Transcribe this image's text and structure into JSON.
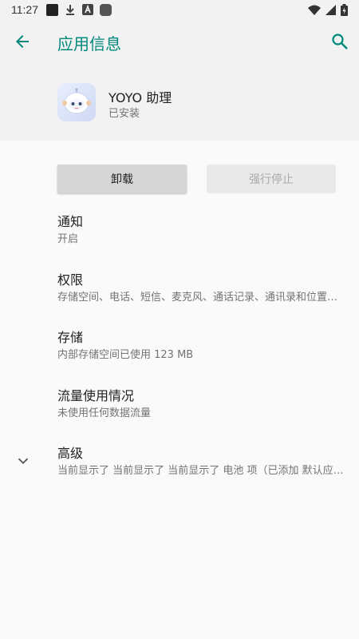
{
  "status_bar": {
    "time": "11:27",
    "icons": [
      "notification-square-icon",
      "download-icon",
      "app-notification-icon",
      "rounded-square-icon",
      "wifi-icon",
      "signal-icon",
      "battery-icon"
    ]
  },
  "app_bar": {
    "title": "应用信息",
    "accent_color": "#00897b"
  },
  "app": {
    "name": "YOYO 助理",
    "status": "已安装"
  },
  "buttons": {
    "uninstall": "卸载",
    "force_stop": "强行停止"
  },
  "settings": [
    {
      "title": "通知",
      "summary": "开启"
    },
    {
      "title": "权限",
      "summary": "存储空间、电话、短信、麦克风、通话记录、通讯录和位置信息"
    },
    {
      "title": "存储",
      "summary": "内部存储空间已使用 123 MB"
    },
    {
      "title": "流量使用情况",
      "summary": "未使用任何数据流量"
    },
    {
      "title": "高级",
      "summary": "当前显示了 当前显示了 当前显示了 电池 项（已添加 默认应用）"
    }
  ]
}
